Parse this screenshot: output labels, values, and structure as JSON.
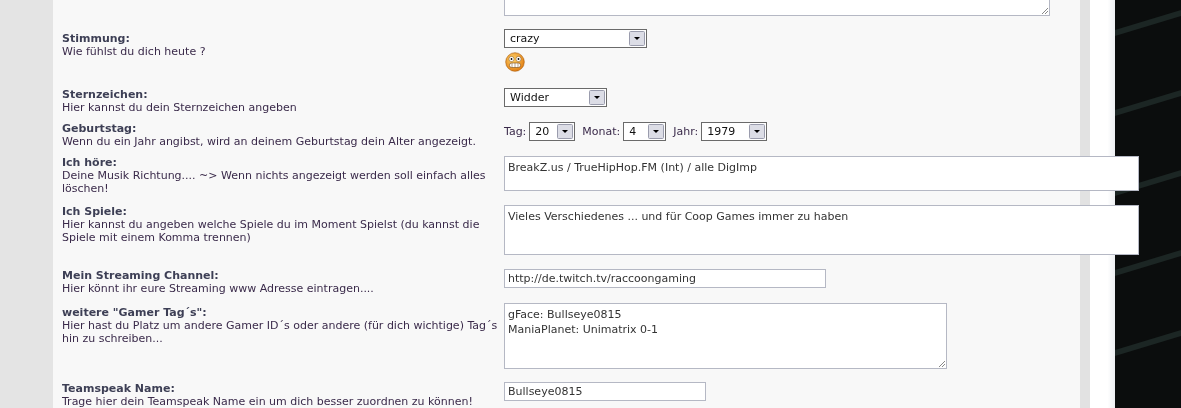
{
  "rows": [
    {
      "control": {
        "kind": "textarea",
        "resizable": true
      }
    },
    {
      "label": "Stimmung:",
      "description": "Wie fühlst du dich heute ?",
      "control": {
        "kind": "select",
        "value": "crazy"
      },
      "icon": {
        "kind": "smiley"
      }
    },
    {
      "label": "Sternzeichen:",
      "description": "Hier kannst du dein Sternzeichen angeben",
      "control": {
        "kind": "select",
        "value": "Widder"
      }
    },
    {
      "label": "Geburtstag:",
      "description": "Wenn du ein Jahr angibst, wird an deinem Geburtstag dein Alter angezeigt.",
      "control": {
        "kind": "date",
        "parts": [
          {
            "label": "Tag:",
            "value": "20"
          },
          {
            "label": "Monat:",
            "value": "4"
          },
          {
            "label": "Jahr:",
            "value": "1979"
          }
        ]
      }
    },
    {
      "label": "Ich höre:",
      "description": "Deine Musik Richtung.... ~> Wenn nichts angezeigt werden soll einfach alles löschen!",
      "control": {
        "kind": "textarea",
        "value": "BreakZ.us / TrueHipHop.FM (Int) / alle DigImp",
        "resizable": false
      }
    },
    {
      "label": "Ich Spiele:",
      "description": "Hier kannst du angeben welche Spiele du im Moment Spielst (du kannst die Spiele mit einem Komma trennen)",
      "control": {
        "kind": "textarea",
        "value": "Vieles Verschiedenes ... und für Coop Games immer zu haben",
        "resizable": false
      }
    },
    {
      "label": "Mein Streaming Channel:",
      "description": "Hier könnt ihr eure Streaming www Adresse eintragen....",
      "control": {
        "kind": "input",
        "value": "http://de.twitch.tv/raccoongaming"
      }
    },
    {
      "label": "weitere \"Gamer Tag´s\":",
      "description": "Hier hast du Platz um andere Gamer ID´s oder andere (für dich wichtige) Tag´s hin zu schreiben...",
      "control": {
        "kind": "textarea",
        "value": "gFace: Bullseye0815\nManiaPlanet: Unimatrix 0-1",
        "resizable": true
      }
    },
    {
      "label": "Teamspeak Name:",
      "description": "Trage hier dein Teamspeak Name ein um dich besser zuordnen zu können!",
      "control": {
        "kind": "input",
        "value": "Bullseye0815"
      }
    }
  ]
}
